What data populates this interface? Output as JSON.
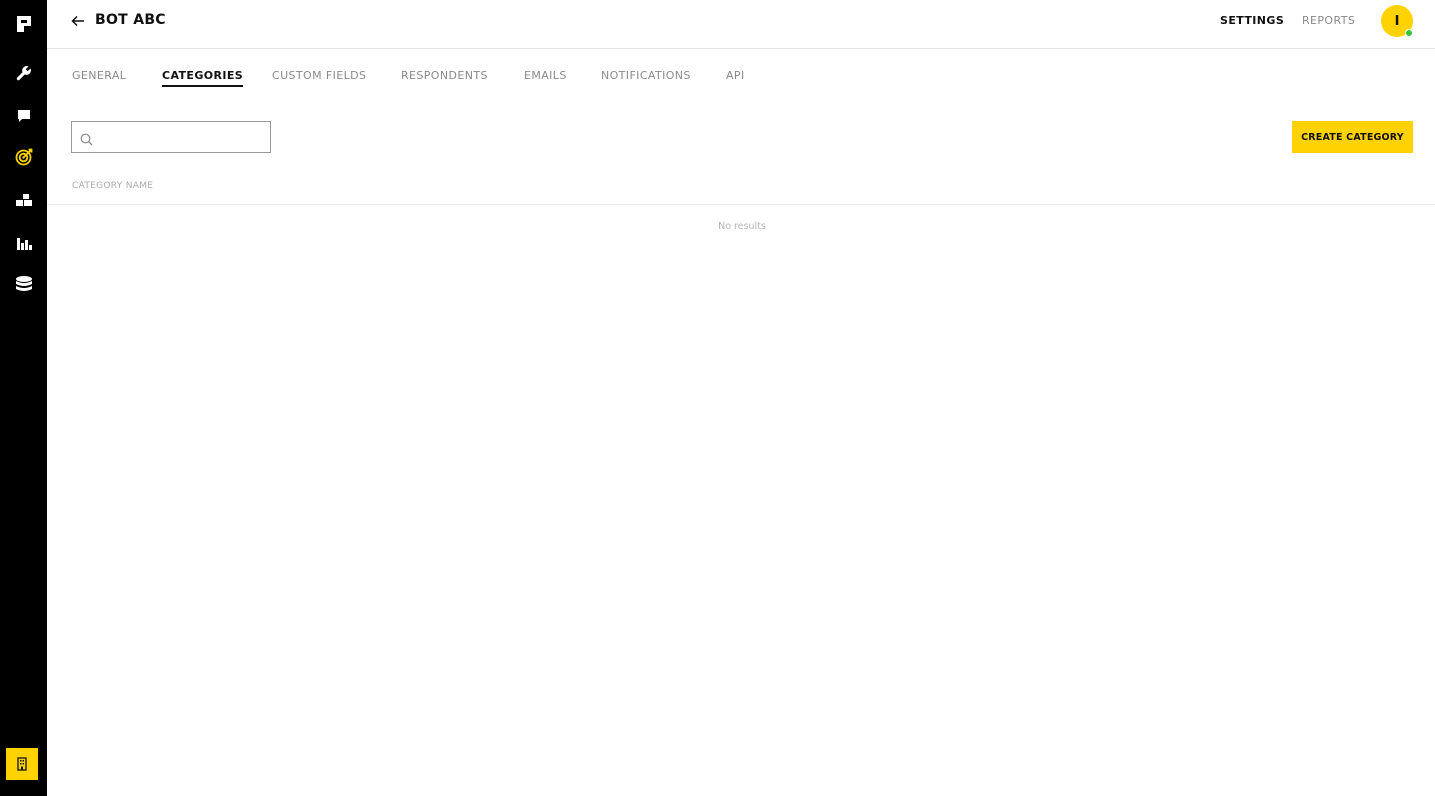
{
  "sidebar": {
    "icons": [
      {
        "name": "logo-icon"
      },
      {
        "name": "wrench-icon"
      },
      {
        "name": "chat-icon"
      },
      {
        "name": "target-icon",
        "active": true,
        "color": "#ffd200"
      },
      {
        "name": "blocks-icon"
      },
      {
        "name": "bar-chart-icon"
      },
      {
        "name": "database-icon"
      }
    ],
    "bottom_icon": {
      "name": "building-icon",
      "color": "#ffd200"
    }
  },
  "header": {
    "title": "BOT ABC",
    "nav": {
      "settings": "SETTINGS",
      "reports": "REPORTS"
    },
    "avatar_initial": "I",
    "status_color": "#33c53b"
  },
  "tabs": [
    {
      "label": "GENERAL",
      "active": false
    },
    {
      "label": "CATEGORIES",
      "active": true
    },
    {
      "label": "CUSTOM FIELDS",
      "active": false
    },
    {
      "label": "RESPONDENTS",
      "active": false
    },
    {
      "label": "EMAILS",
      "active": false
    },
    {
      "label": "NOTIFICATIONS",
      "active": false
    },
    {
      "label": "API",
      "active": false
    }
  ],
  "search": {
    "value": "",
    "placeholder": ""
  },
  "actions": {
    "create_label": "CREATE CATEGORY"
  },
  "table": {
    "columns": [
      "CATEGORY NAME"
    ],
    "rows": [],
    "empty_text": "No results"
  },
  "colors": {
    "accent": "#ffd200",
    "sidebar_bg": "#000000"
  }
}
